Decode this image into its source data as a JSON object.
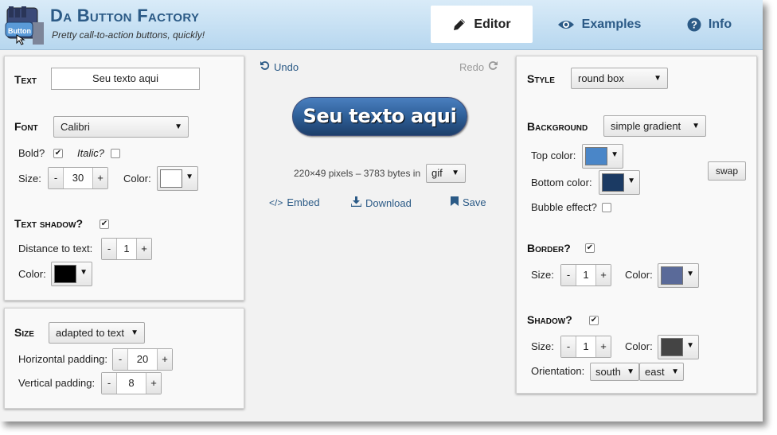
{
  "header": {
    "title": "Da Button Factory",
    "subtitle": "Pretty call-to-action buttons, quickly!",
    "logo_text": "Button",
    "tabs": [
      {
        "label": "Editor",
        "icon": "pencil-icon",
        "active": true
      },
      {
        "label": "Examples",
        "icon": "eye-icon",
        "active": false
      },
      {
        "label": "Info",
        "icon": "question-icon",
        "active": false
      }
    ]
  },
  "text_panel": {
    "text_heading": "Text",
    "text_value": "Seu texto aqui",
    "font_heading": "Font",
    "font_value": "Calibri",
    "bold_label": "Bold?",
    "bold_checked": true,
    "italic_label": "Italic?",
    "italic_checked": false,
    "size_label": "Size:",
    "size_value": "30",
    "color_label": "Color:",
    "text_color": "#ffffff",
    "shadow_heading": "Text shadow?",
    "shadow_checked": true,
    "distance_label": "Distance to text:",
    "distance_value": "1",
    "shadow_color_label": "Color:",
    "shadow_color": "#000000"
  },
  "size_panel": {
    "heading": "Size",
    "mode_value": "adapted to text",
    "hpad_label": "Horizontal padding:",
    "hpad_value": "20",
    "vpad_label": "Vertical padding:",
    "vpad_value": "8"
  },
  "preview": {
    "undo_label": "Undo",
    "redo_label": "Redo",
    "button_text": "Seu texto aqui",
    "info_text": "220×49 pixels – 3783 bytes in",
    "format_value": "gif",
    "embed_label": "Embed",
    "download_label": "Download",
    "save_label": "Save"
  },
  "style_panel": {
    "style_heading": "Style",
    "style_value": "round box",
    "background_heading": "Background",
    "background_value": "simple gradient",
    "top_color_label": "Top color:",
    "top_color": "#4a86c8",
    "bottom_color_label": "Bottom color:",
    "bottom_color": "#1b3a63",
    "swap_label": "swap",
    "bubble_label": "Bubble effect?",
    "bubble_checked": false,
    "border_heading": "Border?",
    "border_checked": true,
    "border_size_label": "Size:",
    "border_size_value": "1",
    "border_color_label": "Color:",
    "border_color": "#5a6a99",
    "shadow_heading": "Shadow?",
    "shadow_checked": true,
    "shadow_size_label": "Size:",
    "shadow_size_value": "1",
    "shadow_color_label": "Color:",
    "shadow_color": "#444444",
    "orientation_label": "Orientation:",
    "orientation_v": "south",
    "orientation_h": "east"
  }
}
